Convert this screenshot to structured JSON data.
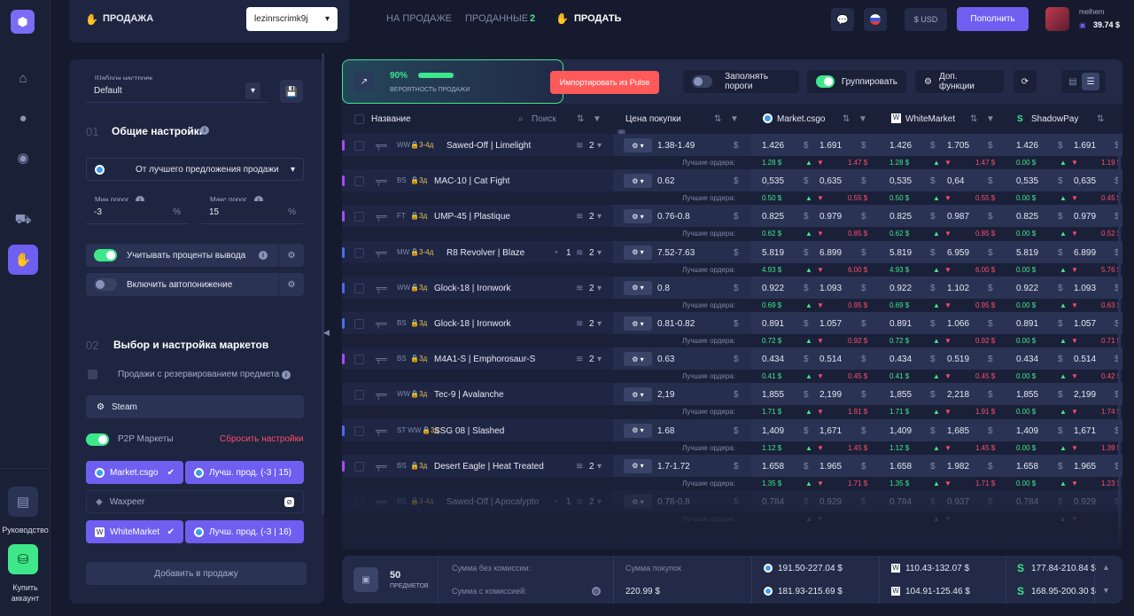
{
  "topbar": {
    "section_title": "ПРОДАЖА",
    "account_select": "lezinrscrimk9j",
    "tabs": [
      {
        "label": "НА ПРОДАЖЕ"
      },
      {
        "label": "ПРОДАННЫЕ",
        "count": "2"
      },
      {
        "label": "ПРОДАТЬ"
      }
    ],
    "currency": "$ USD",
    "replenish_label": "Пополнить",
    "user": {
      "name": "melhem",
      "balance": "39.74 $"
    }
  },
  "sidebar": {
    "guide_label": "Руководство",
    "buy_label_1": "Купить",
    "buy_label_2": "аккаунт"
  },
  "settings": {
    "template_label": "Шаблон настроек",
    "template_value": "Default",
    "section1_num": "01",
    "section1_title": "Общие настройки",
    "price_source": "От лучшего предложения продажи",
    "min_label": "Мин.порог",
    "min_value": "-3",
    "max_label": "Макс.порог",
    "max_value": "15",
    "percent": "%",
    "withdraw_label": "Учитывать проценты вывода",
    "autodecrease_label": "Включить автопонижение",
    "section2_num": "02",
    "section2_title": "Выбор и настройка маркетов",
    "reserve_label": "Продажи с резервированием предмета",
    "steam_label": "Steam",
    "p2p_label": "P2P Маркеты",
    "reset_label": "Сбросить настройки",
    "markets": [
      {
        "name": "Market.csgo",
        "mode": "Лучш. прод. (-3 | 15)"
      },
      {
        "name": "Waxpeer"
      },
      {
        "name": "WhiteMarket",
        "mode": "Лучш. прод. (-3 | 16)"
      }
    ],
    "add_button": "Добавить в продажу"
  },
  "toolbar": {
    "percent": "90%",
    "probability_label": "ВЕРОЯТНОСТЬ ПРОДАЖИ",
    "probability_value": 0.9,
    "import_label": "Импортировать из Pulse",
    "fill_label": "Заполнять пороги",
    "group_label": "Группировать",
    "extra_label": "Доп. функции"
  },
  "table": {
    "headers": {
      "name": "Название",
      "search_placeholder": "Поиск",
      "buy_price": "Цена покупки",
      "m1": "Market.csgo",
      "m2": "WhiteMarket",
      "m3": "ShadowPay"
    },
    "best_orders_label": "Лучшие ордера:",
    "dollar": "$",
    "rows": [
      {
        "stripe": "#a94cf0",
        "wear": "WW",
        "lock": "3-4д",
        "name": "Sawed-Off | Limelight",
        "qty": "2",
        "buy": "1.38-1.49",
        "m1a": "1.426",
        "m1b": "1.691",
        "m2a": "1.426",
        "m2b": "1.705",
        "m3a": "1.426",
        "m3b": "1.691",
        "s1a": "1.28 $",
        "s1b": "1.47 $",
        "s2a": "1.28 $",
        "s2b": "1.47 $",
        "s3a": "0.00 $",
        "s3b": "1.19 $"
      },
      {
        "stripe": "#a94cf0",
        "wear": "BS",
        "lock": "3д",
        "name": "MAC-10 | Cat Fight",
        "qty": "",
        "buy": "0.62",
        "m1a": "0,535",
        "m1b": "0,635",
        "m2a": "0,535",
        "m2b": "0,64",
        "m3a": "0,535",
        "m3b": "0,635",
        "s1a": "0.50 $",
        "s1b": "0.55 $",
        "s2a": "0.50 $",
        "s2b": "0.55 $",
        "s3a": "0.00 $",
        "s3b": "0.45 $"
      },
      {
        "stripe": "#a94cf0",
        "wear": "FT",
        "lock": "3д",
        "name": "UMP-45 | Plastique",
        "qty": "2",
        "buy": "0.76-0.8",
        "m1a": "0.825",
        "m1b": "0.979",
        "m2a": "0.825",
        "m2b": "0.987",
        "m3a": "0.825",
        "m3b": "0.979",
        "s1a": "0.62 $",
        "s1b": "0.85 $",
        "s2a": "0.62 $",
        "s2b": "0.85 $",
        "s3a": "0.00 $",
        "s3b": "0.52 $"
      },
      {
        "stripe": "#4b6cf0",
        "wear": "MW",
        "lock": "3-4д",
        "name": "R8 Revolver | Blaze",
        "qty": "2",
        "extra": "1",
        "buy": "7.52-7.63",
        "m1a": "5.819",
        "m1b": "6.899",
        "m2a": "5.819",
        "m2b": "6.959",
        "m3a": "5.819",
        "m3b": "6.899",
        "s1a": "4.93 $",
        "s1b": "6.00 $",
        "s2a": "4.93 $",
        "s2b": "6.00 $",
        "s3a": "0.00 $",
        "s3b": "5.76 $"
      },
      {
        "stripe": "#4b6cf0",
        "wear": "WW",
        "lock": "3д",
        "name": "Glock-18 | Ironwork",
        "qty": "2",
        "buy": "0.8",
        "m1a": "0.922",
        "m1b": "1.093",
        "m2a": "0.922",
        "m2b": "1.102",
        "m3a": "0.922",
        "m3b": "1.093",
        "s1a": "0.69 $",
        "s1b": "0.95 $",
        "s2a": "0.69 $",
        "s2b": "0.95 $",
        "s3a": "0.00 $",
        "s3b": "0.63 $"
      },
      {
        "stripe": "#4b6cf0",
        "wear": "BS",
        "lock": "3д",
        "name": "Glock-18 | Ironwork",
        "qty": "2",
        "buy": "0.81-0.82",
        "m1a": "0.891",
        "m1b": "1.057",
        "m2a": "0.891",
        "m2b": "1.066",
        "m3a": "0.891",
        "m3b": "1.057",
        "s1a": "0.72 $",
        "s1b": "0.92 $",
        "s2a": "0.72 $",
        "s2b": "0.92 $",
        "s3a": "0.00 $",
        "s3b": "0.71 $"
      },
      {
        "stripe": "#a94cf0",
        "wear": "BS",
        "lock": "3д",
        "name": "M4A1-S | Emphorosaur-S",
        "qty": "2",
        "buy": "0.63",
        "m1a": "0.434",
        "m1b": "0.514",
        "m2a": "0.434",
        "m2b": "0.519",
        "m3a": "0.434",
        "m3b": "0.514",
        "s1a": "0.41 $",
        "s1b": "0.45 $",
        "s2a": "0.41 $",
        "s2b": "0.45 $",
        "s3a": "0.00 $",
        "s3b": "0.42 $"
      },
      {
        "stripe": "",
        "wear": "WW",
        "lock": "3д",
        "name": "Tec-9 | Avalanche",
        "qty": "",
        "buy": "2,19",
        "m1a": "1,855",
        "m1b": "2,199",
        "m2a": "1,855",
        "m2b": "2,218",
        "m3a": "1,855",
        "m3b": "2,199",
        "s1a": "1.71 $",
        "s1b": "1.91 $",
        "s2a": "1.71 $",
        "s2b": "1.91 $",
        "s3a": "0.00 $",
        "s3b": "1.74 $"
      },
      {
        "stripe": "#4b6cf0",
        "wear": "ST WW",
        "lock": "3д",
        "name": "SSG 08 | Slashed",
        "qty": "",
        "buy": "1.68",
        "m1a": "1,409",
        "m1b": "1,671",
        "m2a": "1,409",
        "m2b": "1,685",
        "m3a": "1,409",
        "m3b": "1,671",
        "s1a": "1.12 $",
        "s1b": "1.45 $",
        "s2a": "1.12 $",
        "s2b": "1.45 $",
        "s3a": "0.00 $",
        "s3b": "1.39 $"
      },
      {
        "stripe": "#a94cf0",
        "wear": "BS",
        "lock": "3д",
        "name": "Desert Eagle | Heat Treated",
        "qty": "2",
        "buy": "1.7-1.72",
        "m1a": "1.658",
        "m1b": "1.965",
        "m2a": "1.658",
        "m2b": "1.982",
        "m3a": "1.658",
        "m3b": "1.965",
        "s1a": "1.35 $",
        "s1b": "1.71 $",
        "s2a": "1.35 $",
        "s2b": "1.71 $",
        "s3a": "0.00 $",
        "s3b": "1.23 $"
      },
      {
        "stripe": "",
        "wear": "BS",
        "lock": "3-4д",
        "name": "Sawed-Off | Apocalypto",
        "qty": "2",
        "extra": "1",
        "buy": "0.78-0.8",
        "m1a": "0.784",
        "m1b": "0.929",
        "m2a": "0.784",
        "m2b": "0.937",
        "m3a": "0.784",
        "m3b": "0.929",
        "s1a": "",
        "s1b": "",
        "s2a": "",
        "s2b": "",
        "s3a": "",
        "s3b": ""
      }
    ]
  },
  "summary": {
    "count": "50",
    "count_label": "ПРЕДМЕТОВ",
    "sum_no_fee_label": "Сумма без комиссии:",
    "sum_fee_label": "Сумма с комиссией:",
    "purchase_label": "Сумма покупок",
    "purchase_value": "220.99 $",
    "m1_no_fee": "191.50-227.04 $",
    "m1_fee": "181.93-215.69 $",
    "m2_no_fee": "110.43-132.07 $",
    "m2_fee": "104.91-125.46 $",
    "m3_no_fee": "177.84-210.84 $",
    "m3_fee": "168.95-200.30 $"
  }
}
